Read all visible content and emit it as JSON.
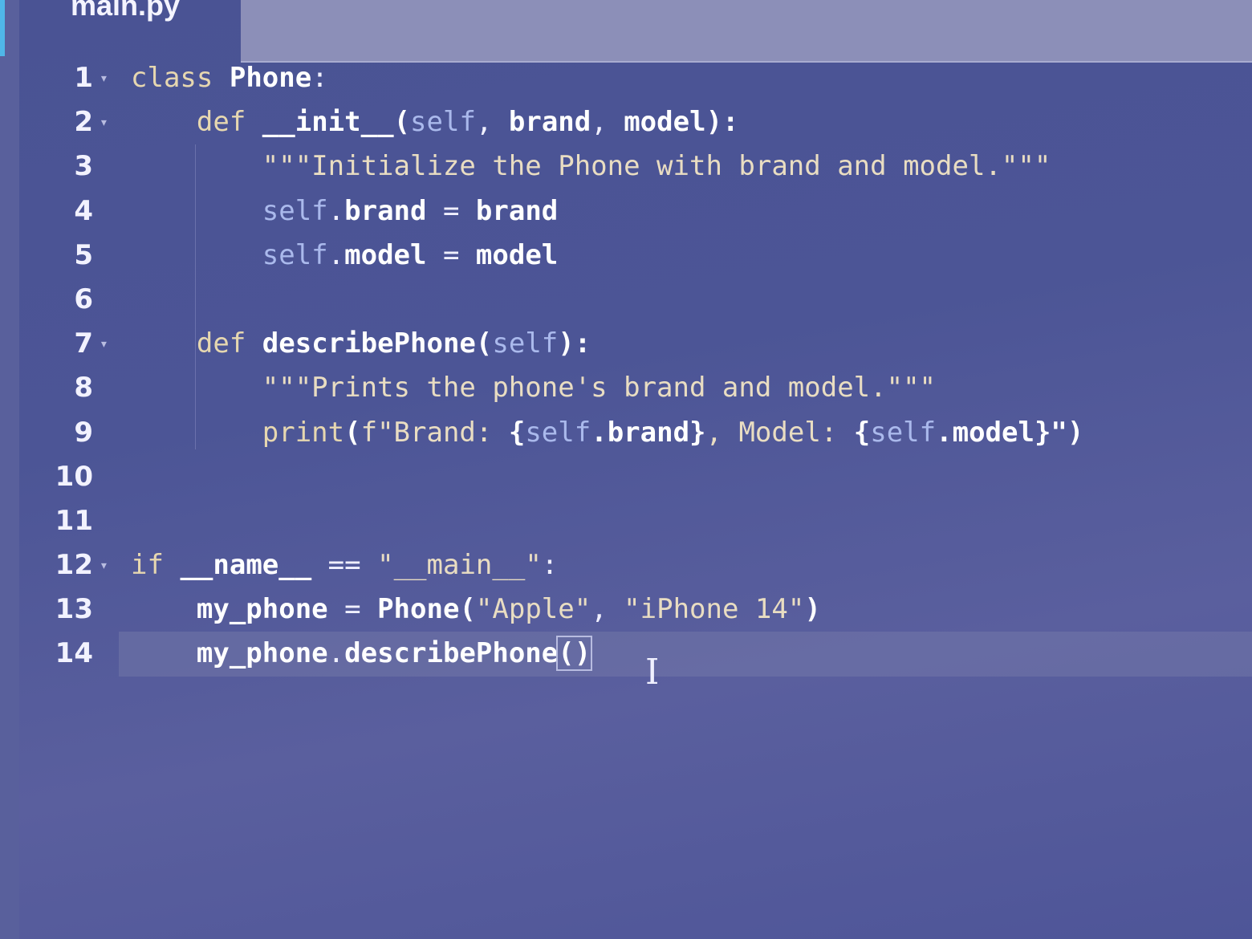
{
  "tab": {
    "label": "main.py"
  },
  "colors": {
    "background": "#4a5394",
    "keyword": "#e6d7b0",
    "self": "#aab9ec",
    "string": "#e9ddc2",
    "identifier": "#ffffff",
    "accent": "#4fb6e8"
  },
  "active_line": 14,
  "lines": [
    {
      "n": "1",
      "fold": true,
      "indent": 0,
      "tokens": [
        [
          "class",
          "kw"
        ],
        [
          " ",
          "p"
        ],
        [
          "Phone",
          "id"
        ],
        [
          ":",
          "p"
        ]
      ]
    },
    {
      "n": "2",
      "fold": true,
      "indent": 1,
      "tokens": [
        [
          "def",
          "kw"
        ],
        [
          " ",
          "p"
        ],
        [
          "__init__",
          "id"
        ],
        [
          "(",
          "id"
        ],
        [
          "self",
          "self"
        ],
        [
          ", ",
          "p"
        ],
        [
          "brand",
          "id"
        ],
        [
          ", ",
          "p"
        ],
        [
          "model",
          "id"
        ],
        [
          "):",
          "id"
        ]
      ]
    },
    {
      "n": "3",
      "fold": false,
      "indent": 2,
      "tokens": [
        [
          "\"\"\"Initialize the Phone with brand and model.\"\"\"",
          "str"
        ]
      ]
    },
    {
      "n": "4",
      "fold": false,
      "indent": 2,
      "tokens": [
        [
          "self",
          "self"
        ],
        [
          ".",
          "p"
        ],
        [
          "brand",
          "id"
        ],
        [
          " = ",
          "p"
        ],
        [
          "brand",
          "id"
        ]
      ]
    },
    {
      "n": "5",
      "fold": false,
      "indent": 2,
      "tokens": [
        [
          "self",
          "self"
        ],
        [
          ".",
          "p"
        ],
        [
          "model",
          "id"
        ],
        [
          " = ",
          "p"
        ],
        [
          "model",
          "id"
        ]
      ]
    },
    {
      "n": "6",
      "fold": false,
      "indent": 0,
      "tokens": []
    },
    {
      "n": "7",
      "fold": true,
      "indent": 1,
      "tokens": [
        [
          "def",
          "kw"
        ],
        [
          " ",
          "p"
        ],
        [
          "describePhone",
          "id"
        ],
        [
          "(",
          "id"
        ],
        [
          "self",
          "self"
        ],
        [
          "):",
          "id"
        ]
      ]
    },
    {
      "n": "8",
      "fold": false,
      "indent": 2,
      "tokens": [
        [
          "\"\"\"Prints the phone's brand and model.\"\"\"",
          "str"
        ]
      ]
    },
    {
      "n": "9",
      "fold": false,
      "indent": 2,
      "tokens": [
        [
          "print",
          "kw"
        ],
        [
          "(",
          "id"
        ],
        [
          "f\"Brand: ",
          "str"
        ],
        [
          "{",
          "id"
        ],
        [
          "self",
          "self"
        ],
        [
          ".brand}",
          "id"
        ],
        [
          ", Model: ",
          "str"
        ],
        [
          "{",
          "id"
        ],
        [
          "self",
          "self"
        ],
        [
          ".model}",
          "id"
        ],
        [
          "\")",
          "id"
        ]
      ]
    },
    {
      "n": "10",
      "fold": false,
      "indent": 0,
      "tokens": []
    },
    {
      "n": "11",
      "fold": false,
      "indent": 0,
      "tokens": []
    },
    {
      "n": "12",
      "fold": true,
      "indent": 0,
      "tokens": [
        [
          "if",
          "kw"
        ],
        [
          " ",
          "p"
        ],
        [
          "__name__",
          "id"
        ],
        [
          " == ",
          "p"
        ],
        [
          "\"__main__\"",
          "str"
        ],
        [
          ":",
          "p"
        ]
      ]
    },
    {
      "n": "13",
      "fold": false,
      "indent": 1,
      "tokens": [
        [
          "my_phone",
          "id"
        ],
        [
          " = ",
          "p"
        ],
        [
          "Phone",
          "id"
        ],
        [
          "(",
          "id"
        ],
        [
          "\"Apple\"",
          "str"
        ],
        [
          ", ",
          "p"
        ],
        [
          "\"iPhone 14\"",
          "str"
        ],
        [
          ")",
          "id"
        ]
      ]
    },
    {
      "n": "14",
      "fold": false,
      "indent": 1,
      "tokens": [
        [
          "my_phone",
          "id"
        ],
        [
          ".",
          "p"
        ],
        [
          "describePhone",
          "id"
        ],
        [
          "()",
          "match"
        ]
      ]
    }
  ]
}
